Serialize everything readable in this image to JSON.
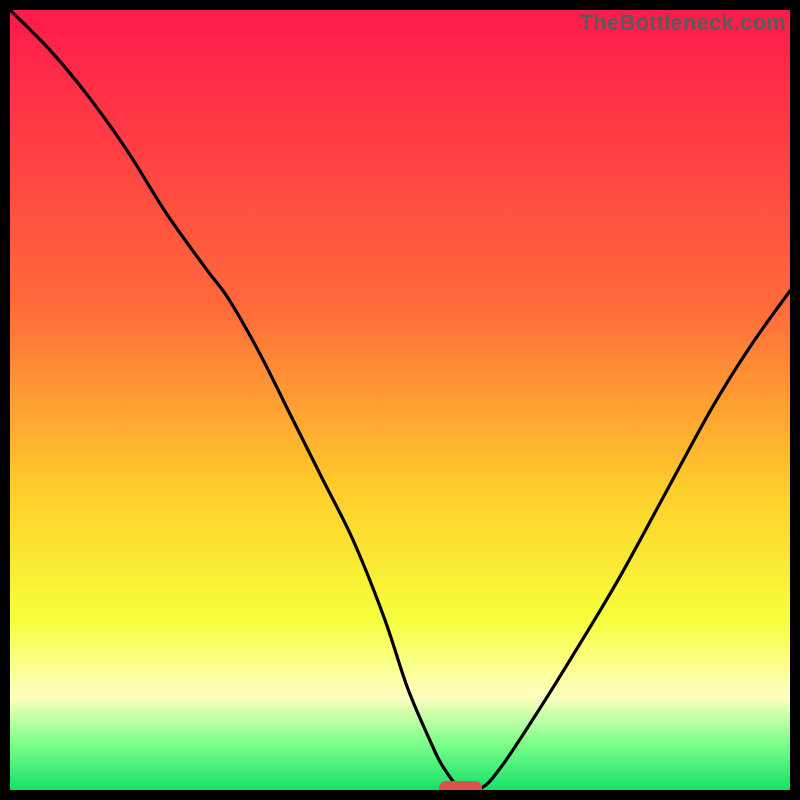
{
  "watermark": {
    "text": "TheBottleneck.com"
  },
  "colors": {
    "top": "#ff1a4b",
    "upper_mid": "#ff6a3a",
    "mid": "#ffcf2a",
    "lower_mid": "#f6ff3a",
    "pale": "#ffffc0",
    "green_light": "#7dff8a",
    "green": "#14e06a",
    "curve": "#000000",
    "marker": "#d9534f",
    "frame": "#000000"
  },
  "chart_data": {
    "type": "line",
    "title": "",
    "xlabel": "",
    "ylabel": "",
    "xlim": [
      0,
      1
    ],
    "ylim": [
      0,
      1
    ],
    "minimum_x": 0.578,
    "series": [
      {
        "name": "bottleneck-curve",
        "x": [
          0.0,
          0.05,
          0.1,
          0.15,
          0.2,
          0.25,
          0.28,
          0.32,
          0.36,
          0.4,
          0.44,
          0.48,
          0.51,
          0.54,
          0.555,
          0.578,
          0.605,
          0.63,
          0.67,
          0.72,
          0.78,
          0.84,
          0.9,
          0.95,
          1.0
        ],
        "y": [
          1.0,
          0.95,
          0.89,
          0.82,
          0.74,
          0.67,
          0.63,
          0.56,
          0.48,
          0.4,
          0.32,
          0.22,
          0.13,
          0.06,
          0.03,
          0.002,
          0.003,
          0.03,
          0.09,
          0.17,
          0.27,
          0.38,
          0.49,
          0.57,
          0.64
        ]
      }
    ],
    "marker": {
      "x_center": 0.578,
      "y": 0.002,
      "width_frac": 0.055,
      "height_frac": 0.018
    },
    "gradient_stops": [
      {
        "pct": 0,
        "key": "top"
      },
      {
        "pct": 38,
        "key": "upper_mid"
      },
      {
        "pct": 62,
        "key": "mid"
      },
      {
        "pct": 78,
        "key": "lower_mid"
      },
      {
        "pct": 88,
        "key": "pale"
      },
      {
        "pct": 94,
        "key": "green_light"
      },
      {
        "pct": 100,
        "key": "green"
      }
    ]
  }
}
